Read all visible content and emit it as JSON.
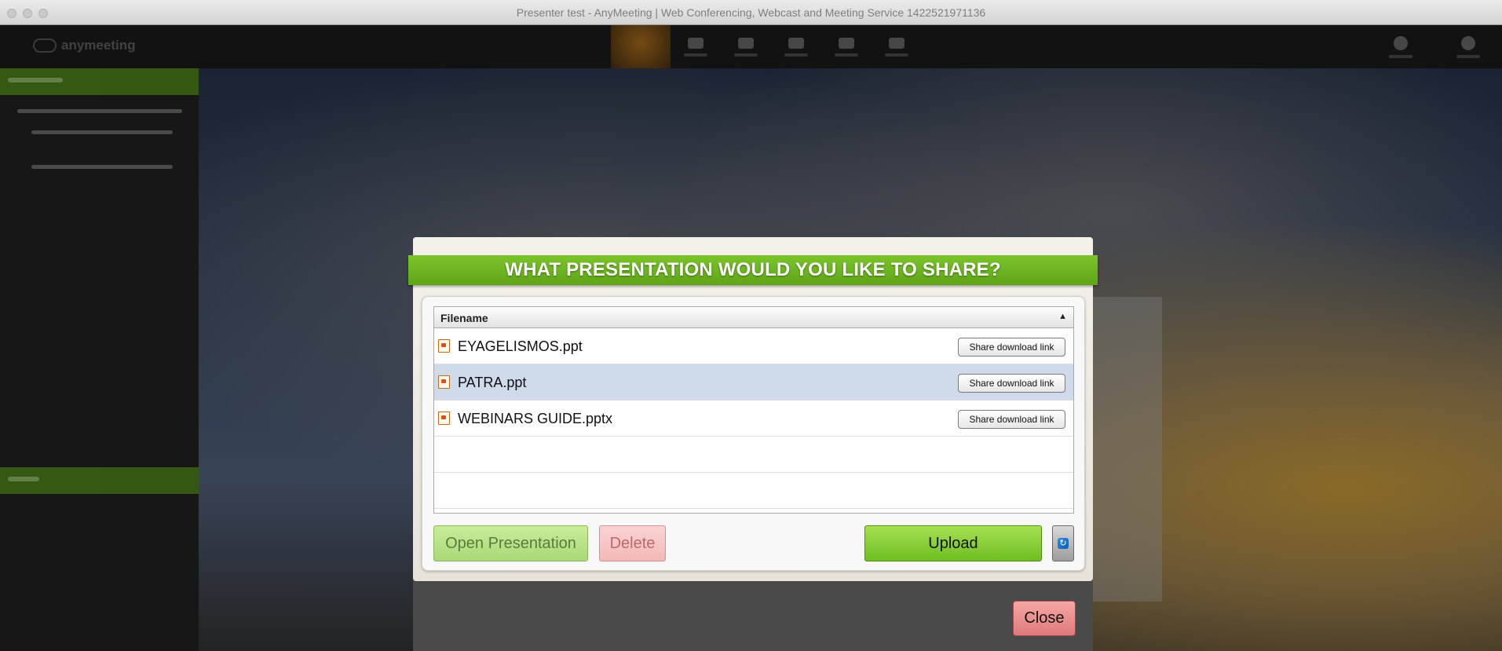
{
  "window": {
    "title": "Presenter test - AnyMeeting | Web Conferencing, Webcast and Meeting Service 1422521971136"
  },
  "app": {
    "logo_text": "anymeeting"
  },
  "dialog": {
    "heading": "WHAT PRESENTATION WOULD YOU LIKE TO SHARE?",
    "table": {
      "column_header": "Filename",
      "sort_indicator": "▲",
      "rows": [
        {
          "filename": "EYAGELISMOS.ppt",
          "action": "Share download link",
          "selected": false
        },
        {
          "filename": "PATRA.ppt",
          "action": "Share download link",
          "selected": true
        },
        {
          "filename": "WEBINARS GUIDE.pptx",
          "action": "Share download link",
          "selected": false
        }
      ]
    },
    "buttons": {
      "open": "Open Presentation",
      "delete": "Delete",
      "upload": "Upload",
      "refresh_icon": "refresh-icon",
      "close": "Close"
    }
  },
  "colors": {
    "ribbon_green": "#6cb520",
    "selected_row": "#cfdaeb",
    "close_red": "#e88f8f"
  }
}
